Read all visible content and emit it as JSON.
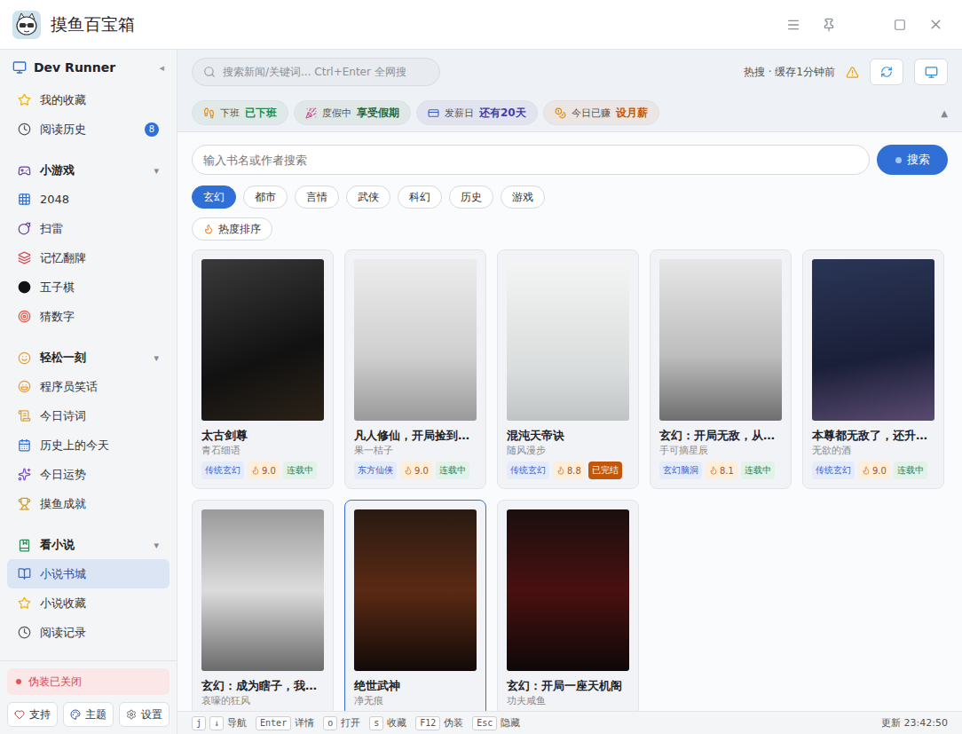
{
  "window": {
    "title": "摸鱼百宝箱"
  },
  "sidebar": {
    "header": {
      "title": "Dev Runner",
      "toggle": "◂"
    },
    "top_items": [
      {
        "label": "我的收藏",
        "selected": false
      },
      {
        "label": "阅读历史",
        "badge": "8",
        "selected": false
      }
    ],
    "sections": [
      {
        "title": "小游戏",
        "arrow": "▾",
        "expanded": true,
        "items": [
          {
            "label": "2048",
            "selected": false
          },
          {
            "label": "扫雷",
            "selected": false
          },
          {
            "label": "记忆翻牌",
            "selected": false
          },
          {
            "label": "五子棋",
            "selected": false
          },
          {
            "label": "猜数字",
            "selected": false
          }
        ]
      },
      {
        "title": "轻松一刻",
        "arrow": "▾",
        "expanded": true,
        "items": [
          {
            "label": "程序员笑话",
            "selected": false
          },
          {
            "label": "今日诗词",
            "selected": false
          },
          {
            "label": "历史上的今天",
            "selected": false
          },
          {
            "label": "今日运势",
            "selected": false
          },
          {
            "label": "摸鱼成就",
            "selected": false
          }
        ]
      },
      {
        "title": "看小说",
        "arrow": "▾",
        "expanded": true,
        "items": [
          {
            "label": "小说书城",
            "selected": true
          },
          {
            "label": "小说收藏",
            "selected": false
          },
          {
            "label": "阅读记录",
            "selected": false
          }
        ]
      }
    ],
    "disguise": {
      "label": "伪装已关闭",
      "on": false
    },
    "buttons": [
      "支持",
      "主题",
      "设置"
    ]
  },
  "topbar": {
    "search_placeholder": "搜索新闻/关键词... Ctrl+Enter 全网搜",
    "hot_status": "热搜 · 缓存1分钟前"
  },
  "strip": {
    "chips": [
      {
        "label": "下班",
        "value": "已下班",
        "color": "#1f8a4c"
      },
      {
        "label": "度假中",
        "value": "享受假期",
        "color": "#1c6b3c"
      },
      {
        "label": "发薪日",
        "value": "还有20天",
        "color": "#3f3fb0"
      },
      {
        "label": "今日已赚",
        "value": "设月薪",
        "color": "#c2570c"
      }
    ],
    "collapse": "▲"
  },
  "novel": {
    "search_placeholder": "输入书名或作者搜索",
    "search_button": "搜索",
    "categories": [
      {
        "label": "玄幻",
        "selected": true
      },
      {
        "label": "都市",
        "selected": false
      },
      {
        "label": "言情",
        "selected": false
      },
      {
        "label": "武侠",
        "selected": false
      },
      {
        "label": "科幻",
        "selected": false
      },
      {
        "label": "历史",
        "selected": false
      },
      {
        "label": "游戏",
        "selected": false
      }
    ],
    "sort": "热度排序",
    "books": [
      {
        "title": "太古剑尊",
        "author": "青石细语",
        "genre": "传统玄幻",
        "score": "9.0",
        "status": "连载中",
        "finished": false,
        "selected": false
      },
      {
        "title": "凡人修仙，开局捡到…",
        "author": "果一桔子",
        "genre": "东方仙侠",
        "score": "9.0",
        "status": "连载中",
        "finished": false,
        "selected": false
      },
      {
        "title": "混沌天帝诀",
        "author": "随风漫步",
        "genre": "传统玄幻",
        "score": "8.8",
        "status": "已完结",
        "finished": true,
        "selected": false
      },
      {
        "title": "玄幻：开局无敌，从…",
        "author": "手可摘星辰",
        "genre": "玄幻脑洞",
        "score": "8.1",
        "status": "连载中",
        "finished": false,
        "selected": false
      },
      {
        "title": "本尊都无敌了，还升…",
        "author": "无欲的酒",
        "genre": "传统玄幻",
        "score": "9.0",
        "status": "连载中",
        "finished": false,
        "selected": false
      },
      {
        "title": "玄幻：成为瞎子，我…",
        "author": "哀嚎的狂风",
        "selected": false
      },
      {
        "title": "绝世武神",
        "author": "净无痕",
        "selected": true
      },
      {
        "title": "玄幻：开局一座天机阁",
        "author": "功夫咸鱼",
        "selected": false
      }
    ]
  },
  "status_bar": {
    "shortcuts": [
      {
        "keys": [
          "j",
          "↓"
        ],
        "label": "导航"
      },
      {
        "keys": [
          "Enter"
        ],
        "label": "详情"
      },
      {
        "keys": [
          "o"
        ],
        "label": "打开"
      },
      {
        "keys": [
          "s"
        ],
        "label": "收藏"
      },
      {
        "keys": [
          "F12"
        ],
        "label": "伪装"
      },
      {
        "keys": [
          "Esc"
        ],
        "label": "隐藏"
      }
    ],
    "updated": "更新 23:42:50"
  }
}
